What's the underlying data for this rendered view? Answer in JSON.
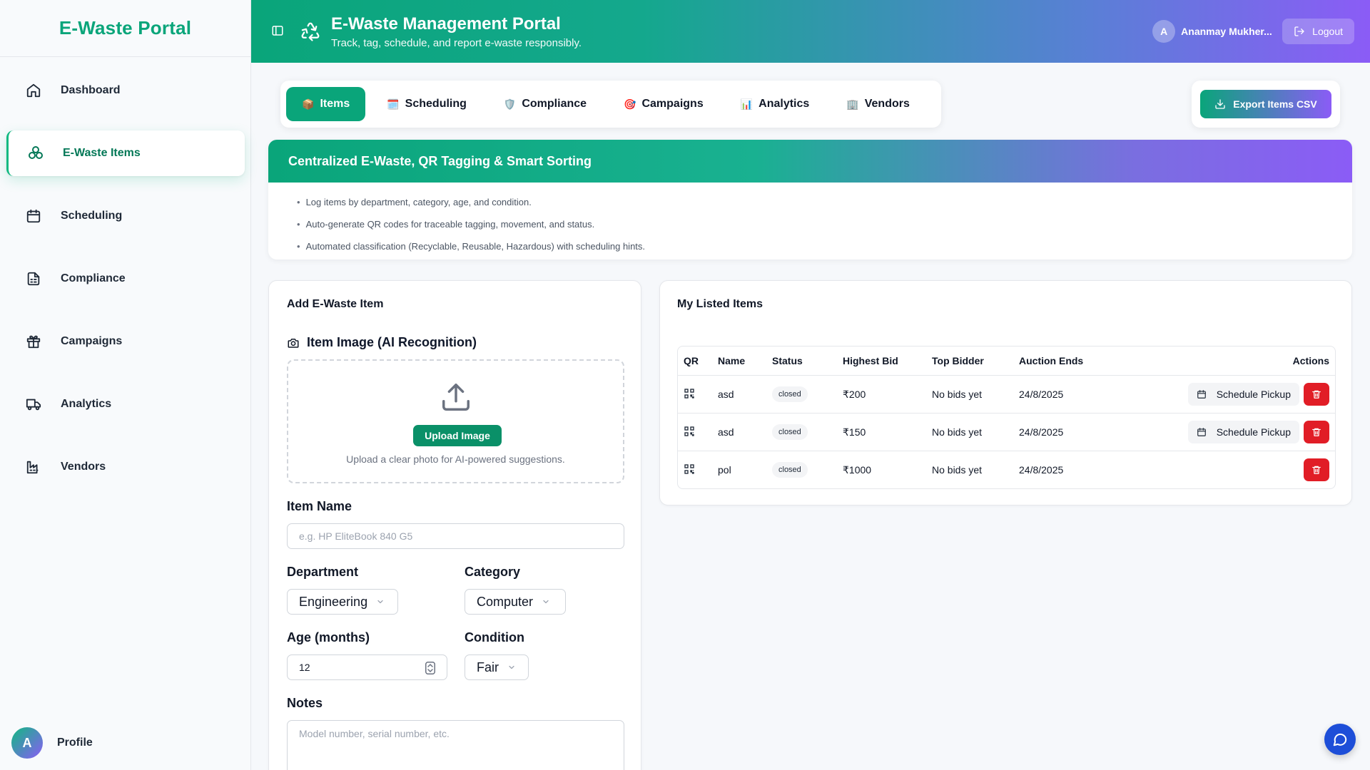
{
  "sidebar": {
    "brand": "E-Waste Portal",
    "items": [
      {
        "label": "Dashboard",
        "icon": "home-icon"
      },
      {
        "label": "E-Waste Items",
        "icon": "recycle-icon"
      },
      {
        "label": "Scheduling",
        "icon": "calendar-icon"
      },
      {
        "label": "Compliance",
        "icon": "document-icon"
      },
      {
        "label": "Campaigns",
        "icon": "gift-icon"
      },
      {
        "label": "Analytics",
        "icon": "truck-icon"
      },
      {
        "label": "Vendors",
        "icon": "factory-icon"
      }
    ],
    "active": "E-Waste Items",
    "profile": {
      "initial": "A",
      "label": "Profile"
    }
  },
  "header": {
    "title": "E-Waste Management Portal",
    "subtitle": "Track, tag, schedule, and report e-waste responsibly.",
    "user_initial": "A",
    "user_name": "Ananmay Mukher...",
    "logout": "Logout"
  },
  "tabs": [
    {
      "label": "Items",
      "icon": "📦"
    },
    {
      "label": "Scheduling",
      "icon": "🗓️"
    },
    {
      "label": "Compliance",
      "icon": "🛡️"
    },
    {
      "label": "Campaigns",
      "icon": "🎯"
    },
    {
      "label": "Analytics",
      "icon": "📊"
    },
    {
      "label": "Vendors",
      "icon": "🏢"
    }
  ],
  "active_tab": "Items",
  "export_button": "Export Items CSV",
  "info": {
    "title": "Centralized E-Waste, QR Tagging & Smart Sorting",
    "bullets": [
      "Log items by department, category, age, and condition.",
      "Auto-generate QR codes for traceable tagging, movement, and status.",
      "Automated classification (Recyclable, Reusable, Hazardous) with scheduling hints."
    ]
  },
  "add_form": {
    "title": "Add E-Waste Item",
    "image_label": "Item Image (AI Recognition)",
    "upload_button": "Upload Image",
    "upload_hint": "Upload a clear photo for AI-powered suggestions.",
    "name_label": "Item Name",
    "name_placeholder": "e.g. HP EliteBook 840 G5",
    "department_label": "Department",
    "department_value": "Engineering",
    "category_label": "Category",
    "category_value": "Computer",
    "age_label": "Age (months)",
    "age_value": "12",
    "condition_label": "Condition",
    "condition_value": "Fair",
    "notes_label": "Notes",
    "notes_placeholder": "Model number, serial number, etc."
  },
  "listed": {
    "title": "My Listed Items",
    "columns": [
      "QR",
      "Name",
      "Status",
      "Highest Bid",
      "Top Bidder",
      "Auction Ends",
      "Actions"
    ],
    "rows": [
      {
        "name": "asd",
        "status": "closed",
        "bid": "₹200",
        "bidder": "No bids yet",
        "ends": "24/8/2025",
        "schedule": "Schedule Pickup"
      },
      {
        "name": "asd",
        "status": "closed",
        "bid": "₹150",
        "bidder": "No bids yet",
        "ends": "24/8/2025",
        "schedule": "Schedule Pickup"
      },
      {
        "name": "pol",
        "status": "closed",
        "bid": "₹1000",
        "bidder": "No bids yet",
        "ends": "24/8/2025",
        "schedule": ""
      }
    ]
  },
  "colors": {
    "brand_green": "#0aa57a",
    "brand_purple": "#8b5cf6",
    "danger": "#e11d26"
  }
}
